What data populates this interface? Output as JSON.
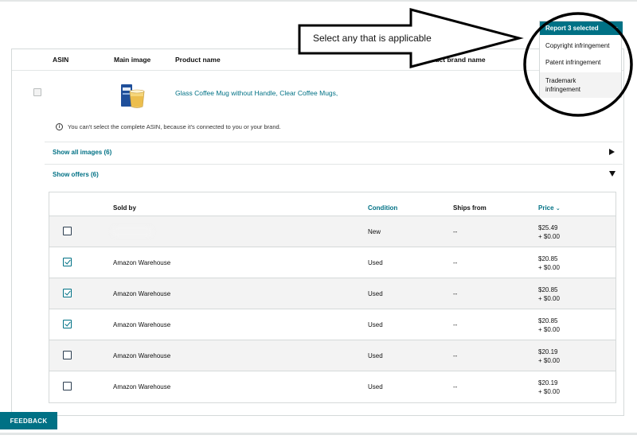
{
  "columns": {
    "asin": "ASIN",
    "main_image": "Main image",
    "product_name": "Product name",
    "brand_name": "Product brand name"
  },
  "product": {
    "name": "Glass Coffee Mug without Handle, Clear Coffee Mugs,",
    "info": "You can't select the complete ASIN, because it's connected to you or your brand."
  },
  "expanders": {
    "show_images": "Show all images (6)",
    "show_offers": "Show offers (6)"
  },
  "offers": {
    "headers": {
      "sold_by": "Sold by",
      "condition": "Condition",
      "ships_from": "Ships from",
      "price": "Price"
    },
    "rows": [
      {
        "sold_by": "",
        "checked": false,
        "condition": "New",
        "ships_from": "--",
        "price": "$25.49",
        "shipping": "+ $0.00"
      },
      {
        "sold_by": "Amazon Warehouse",
        "checked": true,
        "condition": "Used",
        "ships_from": "--",
        "price": "$20.85",
        "shipping": "+ $0.00"
      },
      {
        "sold_by": "Amazon Warehouse",
        "checked": true,
        "condition": "Used",
        "ships_from": "--",
        "price": "$20.85",
        "shipping": "+ $0.00"
      },
      {
        "sold_by": "Amazon Warehouse",
        "checked": true,
        "condition": "Used",
        "ships_from": "--",
        "price": "$20.85",
        "shipping": "+ $0.00"
      },
      {
        "sold_by": "Amazon Warehouse",
        "checked": false,
        "condition": "Used",
        "ships_from": "--",
        "price": "$20.19",
        "shipping": "+ $0.00"
      },
      {
        "sold_by": "Amazon Warehouse",
        "checked": false,
        "condition": "Used",
        "ships_from": "--",
        "price": "$20.19",
        "shipping": "+ $0.00"
      }
    ]
  },
  "report_menu": {
    "button_label": "Report 3 selected",
    "options": [
      "Copyright infringement",
      "Patent infringement",
      "Trademark infringement"
    ]
  },
  "annotation": {
    "text": "Select any that is applicable"
  },
  "feedback": {
    "label": "FEEDBACK"
  },
  "colors": {
    "accent": "#007185",
    "row_alt": "#f3f3f3",
    "border": "#d5d9d9"
  }
}
